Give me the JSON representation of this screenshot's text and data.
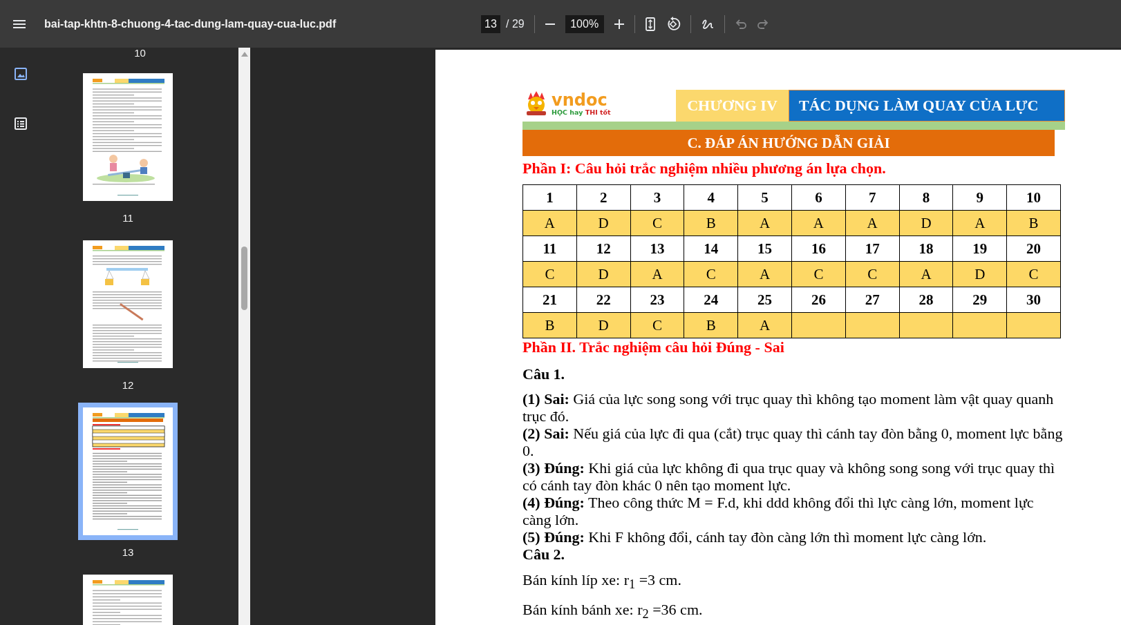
{
  "toolbar": {
    "file_name": "bai-tap-khtn-8-chuong-4-tac-dung-lam-quay-cua-luc.pdf",
    "page_current": "13",
    "page_total": "/ 29",
    "zoom": "100%",
    "undo_disabled": true,
    "redo_disabled": true
  },
  "sidebar": {
    "views": [
      {
        "kind": "thumbnails",
        "selected": true
      },
      {
        "kind": "outline",
        "selected": false
      }
    ],
    "previous_label": "10",
    "thumbnails": [
      {
        "label": "11",
        "selected": false,
        "kind": "seesaw"
      },
      {
        "label": "12",
        "selected": false,
        "kind": "scale"
      },
      {
        "label": "13",
        "selected": true,
        "kind": "table"
      },
      {
        "selected": false,
        "kind": "text"
      }
    ]
  },
  "document": {
    "logo": {
      "name": "vndoc",
      "tagline_1": "HỌC hay",
      "tagline_2": "THI tốt"
    },
    "chapter": "CHƯƠNG IV",
    "chapter_title": "TÁC DỤNG LÀM QUAY CỦA LỰC",
    "section": "C. ĐÁP ÁN HƯỚNG DẪN GIẢI",
    "part_1": "Phần I: Câu hỏi trắc nghiệm nhiều phương án lựa chọn.",
    "answer_table": [
      {
        "kind": "numbers",
        "cells": [
          "1",
          "2",
          "3",
          "4",
          "5",
          "6",
          "7",
          "8",
          "9",
          "10"
        ]
      },
      {
        "kind": "answers",
        "cells": [
          "A",
          "D",
          "C",
          "B",
          "A",
          "A",
          "A",
          "D",
          "A",
          "B"
        ]
      },
      {
        "kind": "numbers",
        "cells": [
          "11",
          "12",
          "13",
          "14",
          "15",
          "16",
          "17",
          "18",
          "19",
          "20"
        ]
      },
      {
        "kind": "answers",
        "cells": [
          "C",
          "D",
          "A",
          "C",
          "A",
          "C",
          "C",
          "A",
          "D",
          "C"
        ]
      },
      {
        "kind": "numbers",
        "cells": [
          "21",
          "22",
          "23",
          "24",
          "25",
          "26",
          "27",
          "28",
          "29",
          "30"
        ]
      },
      {
        "kind": "answers",
        "cells": [
          "B",
          "D",
          "C",
          "B",
          "A"
        ]
      }
    ],
    "part_2": "Phần II. Trắc nghiệm câu hỏi Đúng - Sai",
    "blocks": [
      {
        "kind": "heading",
        "text": "Câu 1."
      },
      {
        "kind": "item",
        "text": "**(1) Sai:** Giá của lực song song với trục quay thì không tạo moment làm vật quay quanh trục đó."
      },
      {
        "kind": "item",
        "text": "**(2) Sai:** Nếu giá của lực đi qua (cắt) trục quay thì cánh tay đòn bằng 0, moment lực bằng 0."
      },
      {
        "kind": "item",
        "text": "**(3) Đúng:** Khi giá của lực không đi qua trục quay và không song song với trục quay thì có cánh tay đòn khác 0 nên tạo moment lực."
      },
      {
        "kind": "item",
        "text": "**(4) Đúng:** Theo công thức M = F.d, khi ddd không đổi thì lực càng lớn, moment lực càng lớn."
      },
      {
        "kind": "item",
        "text": "**(5) Đúng:** Khi F không đổi, cánh tay đòn càng lớn thì moment lực càng lớn."
      },
      {
        "kind": "heading",
        "text": "Câu 2."
      },
      {
        "kind": "line",
        "text": "Bán kính líp xe: r$_{1}$ =3 cm."
      },
      {
        "kind": "line",
        "text": "Bán kính bánh xe: r$_{2}$ =36 cm."
      }
    ]
  }
}
